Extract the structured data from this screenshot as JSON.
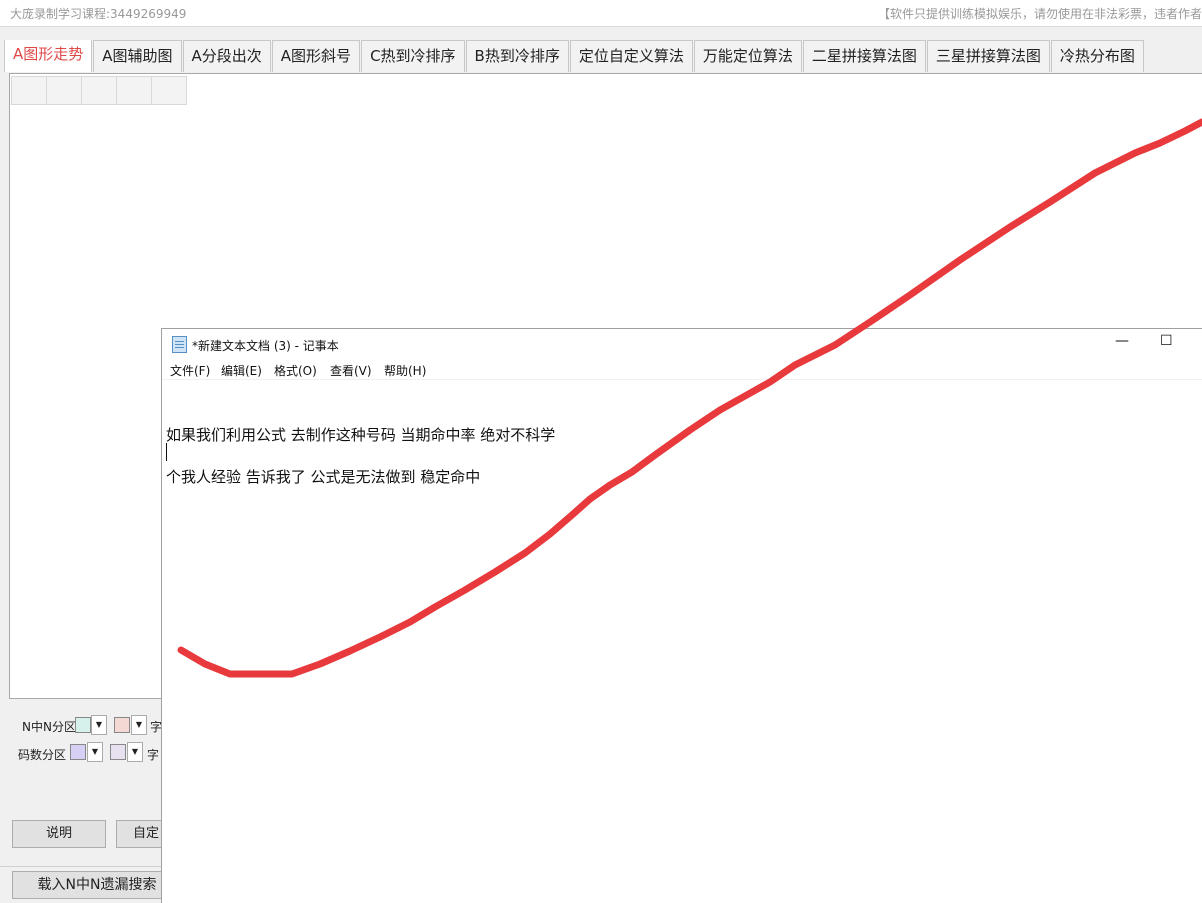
{
  "app": {
    "title_left": "大庞录制学习课程:3449269949",
    "title_right": "【软件只提供训练模拟娱乐，请勿使用在非法彩票，违者作者"
  },
  "tabs": [
    {
      "label": "A图形走势",
      "active": true
    },
    {
      "label": "A图辅助图"
    },
    {
      "label": "A分段出次"
    },
    {
      "label": "A图形斜号"
    },
    {
      "label": "C热到冷排序"
    },
    {
      "label": "B热到冷排序"
    },
    {
      "label": "定位自定义算法"
    },
    {
      "label": "万能定位算法"
    },
    {
      "label": "二星拼接算法图"
    },
    {
      "label": "三星拼接算法图"
    },
    {
      "label": "冷热分布图"
    }
  ],
  "controls": {
    "nzhongn_label": "N中N分区",
    "mashu_label": "码数分区",
    "zi_label": "字",
    "dropdown_glyph": "▼",
    "explain_button": "说明",
    "custom_button": "自定",
    "load_button": "载入N中N遗漏搜索"
  },
  "notepad": {
    "title": "*新建文本文档 (3) - 记事本",
    "minimize": "—",
    "maximize": "☐",
    "menu": [
      "文件(F)",
      "编辑(E)",
      "格式(O)",
      "查看(V)",
      "帮助(H)"
    ],
    "lines": [
      "如果我们利用公式 去制作这种号码  当期命中率 绝对不科学",
      "个我人经验  告诉我了  公式是无法做到 稳定命中"
    ]
  },
  "colors": {
    "accent_tab": "#e04848",
    "stroke": "#e8393c",
    "swatch1": "#d6f0ec",
    "swatch2": "#f4d8d4",
    "swatch3": "#d8d0f4",
    "swatch4": "#e6e0f0"
  }
}
